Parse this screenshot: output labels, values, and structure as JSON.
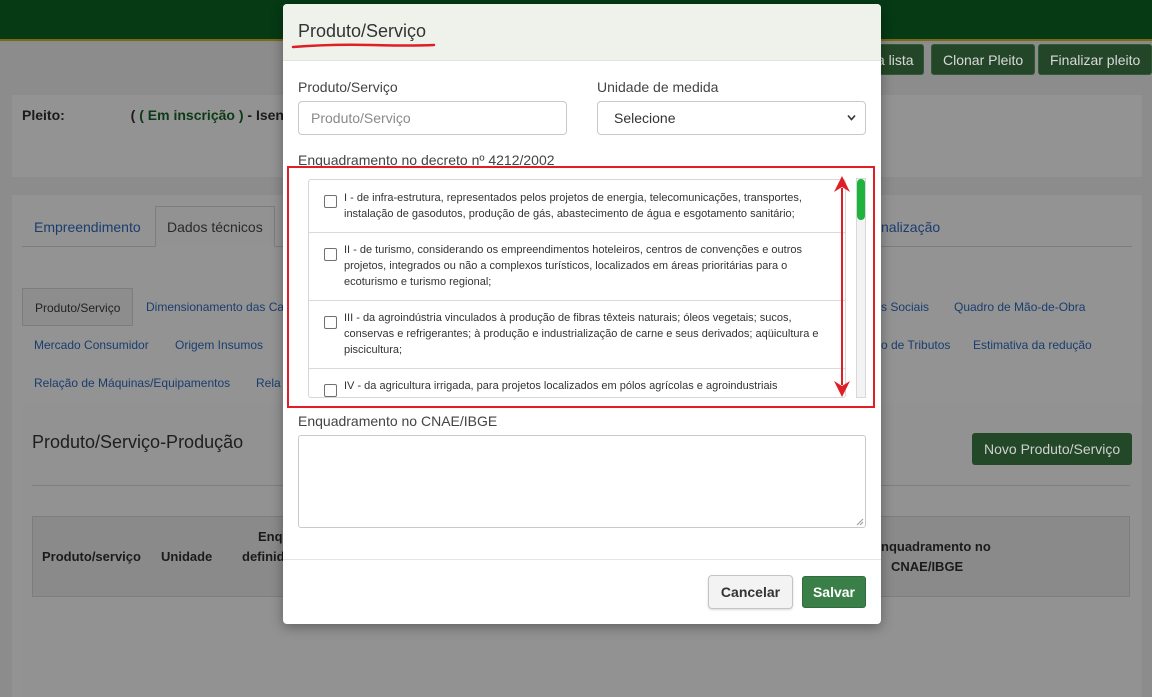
{
  "background": {
    "buttons": [
      "a lista",
      "Clonar Pleito",
      "Finalizar pleito"
    ],
    "pleito": {
      "label": "Pleito:",
      "status": "( Em inscrição )",
      "rest": "- Isenç",
      "prefix": "("
    },
    "main_tabs": [
      {
        "label": "Empreendimento"
      },
      {
        "label": "Dados técnicos"
      },
      {
        "label": "nalização"
      }
    ],
    "sub_tabs": [
      {
        "label": "Produto/Serviço"
      },
      {
        "label": "Dimensionamento das Ca"
      },
      {
        "label": "s Sociais"
      },
      {
        "label": "Quadro de Mão-de-Obra"
      },
      {
        "label": "Mercado Consumidor"
      },
      {
        "label": "Origem Insumos"
      },
      {
        "label": "o de Tributos"
      },
      {
        "label": "Estimativa da redução"
      },
      {
        "label": "Relação de Máquinas/Equipamentos"
      },
      {
        "label": "Rela"
      }
    ],
    "section_title": "Produto/Serviço-Produção",
    "new_button": "Novo Produto/Serviço",
    "table_headers": {
      "produto": "Produto/serviço",
      "unidade": "Unidade",
      "enq_line1": "Enq",
      "enq_line2": "definid",
      "cnae_line1": "nquadramento no",
      "cnae_line2": "CNAE/IBGE"
    }
  },
  "modal": {
    "title": "Produto/Serviço",
    "product_label": "Produto/Serviço",
    "product_placeholder": "Produto/Serviço",
    "unit_label": "Unidade de medida",
    "unit_selected": "Selecione",
    "decree_label": "Enquadramento no decreto nº 4212/2002",
    "decree_items": [
      {
        "text": "I - de infra-estrutura, representados pelos projetos de energia, telecomunicações, transportes, instalação de gasodutos, produção de gás, abastecimento de água e esgotamento sanitário;",
        "checked": false
      },
      {
        "text": "II - de turismo, considerando os empreendimentos hoteleiros, centros de convenções e outros projetos, integrados ou não a complexos turísticos, localizados em áreas prioritárias para o ecoturismo e turismo regional;",
        "checked": false
      },
      {
        "text": "III - da agroindústria vinculados à produção de fibras têxteis naturais; óleos vegetais; sucos, conservas e refrigerantes; à produção e industrialização de carne e seus derivados; aqüicultura e piscicultura;",
        "checked": false
      },
      {
        "text": "IV - da agricultura irrigada, para projetos localizados em pólos agrícolas e agroindustriais",
        "checked": false
      }
    ],
    "cnae_label": "Enquadramento no CNAE/IBGE",
    "cnae_value": "",
    "cancel_button": "Cancelar",
    "save_button": "Salvar"
  },
  "colors": {
    "topbar": "#053a15",
    "save_button": "#3a7f48",
    "scroll_thumb": "#1db33c",
    "annotation_red": "#de1f26"
  }
}
